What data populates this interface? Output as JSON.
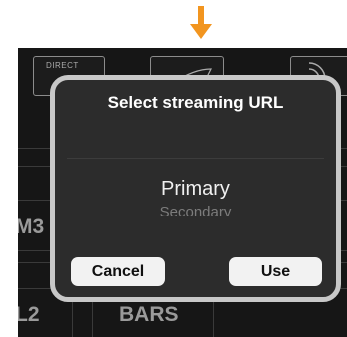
{
  "dialog": {
    "title": "Select streaming URL",
    "options": [
      "Primary",
      "Secondary"
    ],
    "selected": "Primary",
    "cancel_label": "Cancel",
    "use_label": "Use"
  },
  "background": {
    "top_button_text": "DIRECT",
    "left_label_1": "M3",
    "left_label_2": "L2",
    "bottom_label": "BARS"
  },
  "colors": {
    "arrow": "#f2951f",
    "dialog_bg": "#2c2c2c",
    "dialog_border": "#c8c8c8",
    "button_bg": "#f2f2f2"
  }
}
